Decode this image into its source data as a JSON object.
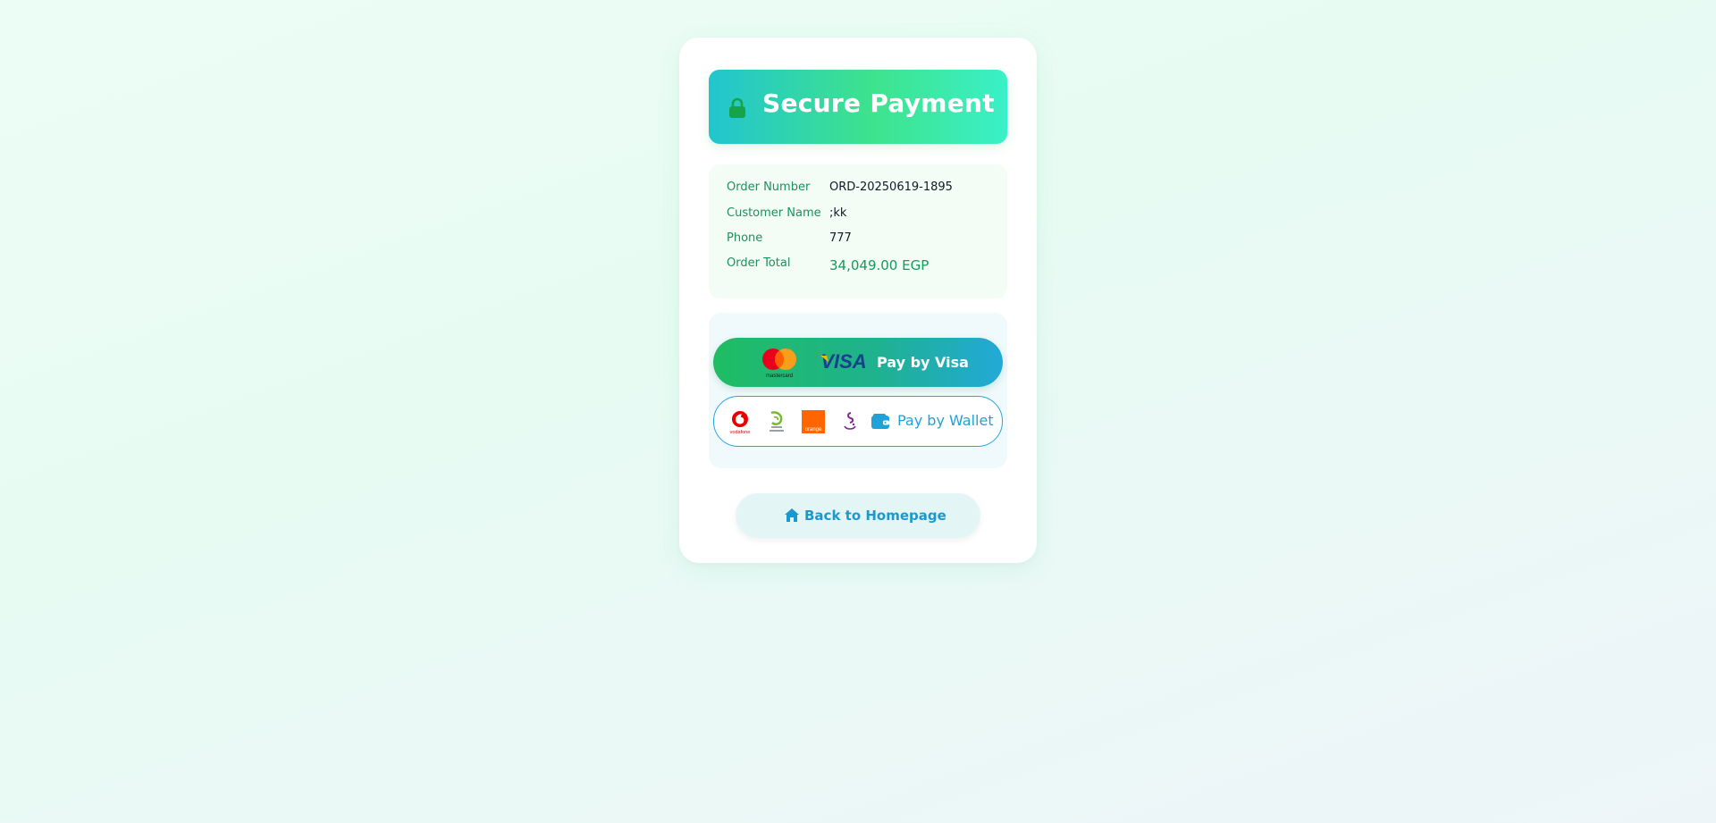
{
  "header": {
    "title": "Secure Payment",
    "icon": "lock-icon"
  },
  "order": {
    "number_label": "Order Number",
    "number_value": "ORD-20250619-1895",
    "customer_label": "Customer Name",
    "customer_value": ";kk",
    "phone_label": "Phone",
    "phone_value": "777",
    "total_label": "Order Total",
    "total_value": "34,049.00 EGP"
  },
  "payment": {
    "visa_label": "Pay by Visa",
    "visa_logos": [
      "mastercard-logo",
      "visa-logo"
    ],
    "mastercard_text": "mastercard",
    "visa_text": "VISA",
    "wallet_label": "Pay by Wallet",
    "wallet_logos": [
      "vodafone-cash-logo",
      "etisalat-cash-logo",
      "orange-cash-logo",
      "we-pay-logo"
    ],
    "vodafone_text": "vodafone",
    "orange_text": "orange"
  },
  "nav": {
    "home_label": "Back to Homepage"
  },
  "colors": {
    "accent_green": "#1f8f5c",
    "accent_blue": "#1fa2d6",
    "header_gradient_start": "#22c5cf",
    "header_gradient_mid": "#3ee38c"
  }
}
